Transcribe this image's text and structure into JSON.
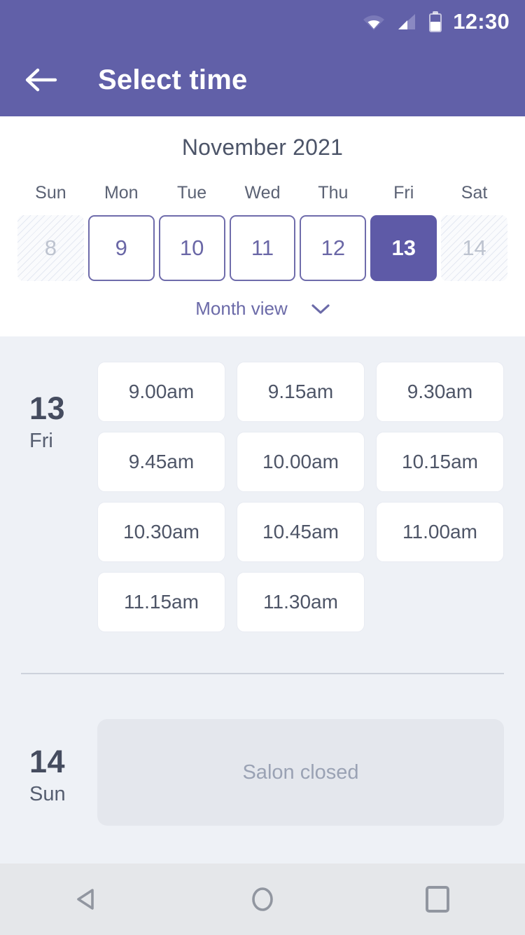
{
  "theme": {
    "primary": "#6160a8",
    "selected_day": "#5e5aa7",
    "page_bg": "#eef1f6",
    "card_bg": "#ffffff",
    "closed_bg": "#e4e7ed",
    "text_dark": "#454c5f",
    "text_muted": "#9aa2b4",
    "navbar_bg": "#e5e7ea"
  },
  "status_bar": {
    "time": "12:30",
    "wifi_icon": "wifi-icon",
    "signal_icon": "signal-icon",
    "battery_icon": "battery-icon"
  },
  "app_bar": {
    "back_icon": "arrow-left-icon",
    "title": "Select time"
  },
  "calendar": {
    "month_title": "November 2021",
    "day_of_week_headers": [
      "Sun",
      "Mon",
      "Tue",
      "Wed",
      "Thu",
      "Fri",
      "Sat"
    ],
    "days": [
      {
        "number": "8",
        "state": "disabled"
      },
      {
        "number": "9",
        "state": "available"
      },
      {
        "number": "10",
        "state": "available"
      },
      {
        "number": "11",
        "state": "available"
      },
      {
        "number": "12",
        "state": "available"
      },
      {
        "number": "13",
        "state": "selected"
      },
      {
        "number": "14",
        "state": "disabled"
      }
    ],
    "view_toggle": {
      "label": "Month view",
      "chevron_icon": "chevron-down-icon"
    }
  },
  "schedule": [
    {
      "date_number": "13",
      "day_of_week": "Fri",
      "status": "open",
      "slots": [
        "9.00am",
        "9.15am",
        "9.30am",
        "9.45am",
        "10.00am",
        "10.15am",
        "10.30am",
        "10.45am",
        "11.00am",
        "11.15am",
        "11.30am"
      ]
    },
    {
      "date_number": "14",
      "day_of_week": "Sun",
      "status": "closed",
      "closed_message": "Salon closed",
      "slots": []
    }
  ],
  "nav_bar": {
    "back_label": "back-triangle-icon",
    "home_label": "home-circle-icon",
    "recents_label": "recents-square-icon"
  }
}
